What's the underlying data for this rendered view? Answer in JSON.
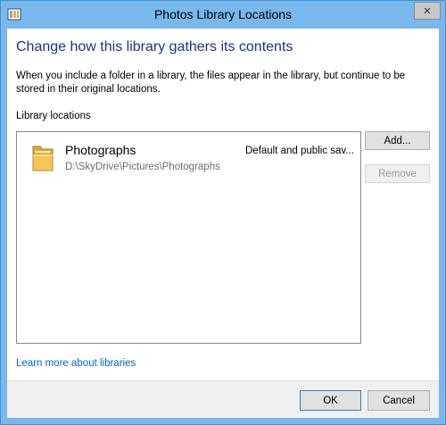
{
  "window": {
    "title": "Photos Library Locations",
    "close_glyph": "✕"
  },
  "dialog": {
    "heading": "Change how this library gathers its contents",
    "description": "When you include a folder in a library, the files appear in the library, but continue to be stored in their original locations.",
    "locations_label": "Library locations",
    "locations": [
      {
        "name": "Photographs",
        "path": "D:\\SkyDrive\\Pictures\\Photographs",
        "status": "Default and public sav...",
        "icon": "folder-icon"
      }
    ],
    "buttons": {
      "add": "Add...",
      "remove": "Remove",
      "ok": "OK",
      "cancel": "Cancel"
    },
    "learn_more_link": "Learn more about libraries"
  },
  "colors": {
    "frame": "#79b8ec",
    "heading": "#1e3287",
    "link": "#0066cc",
    "disabled_text": "#9c9c9c"
  }
}
